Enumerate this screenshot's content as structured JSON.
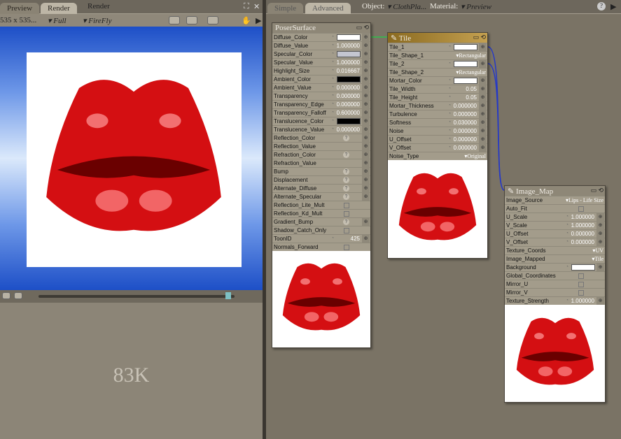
{
  "left": {
    "tabs": [
      "Preview",
      "Render"
    ],
    "title": "Render",
    "resolution": "535 x 535...",
    "quality": "Full",
    "renderer": "FireFly",
    "file_size": "83K"
  },
  "right": {
    "tabs": [
      "Simple",
      "Advanced"
    ],
    "object_label": "Object:",
    "object_value": "ClothPla...",
    "material_label": "Material:",
    "material_value": "Preview",
    "help": "?"
  },
  "nodes": [
    {
      "title": "PoserSurface",
      "rows": [
        {
          "label": "Diffuse_Color",
          "kind": "color",
          "color": "#ffffff"
        },
        {
          "label": "Diffuse_Value",
          "kind": "value",
          "value": "1.000000"
        },
        {
          "label": "Specular_Color",
          "kind": "color",
          "color": "#c4c6d0"
        },
        {
          "label": "Specular_Value",
          "kind": "value",
          "value": "1.000000"
        },
        {
          "label": "Highlight_Size",
          "kind": "value",
          "value": "0.016667"
        },
        {
          "label": "Ambient_Color",
          "kind": "color",
          "color": "#000000"
        },
        {
          "label": "Ambient_Value",
          "kind": "value",
          "value": "0.000000"
        },
        {
          "label": "Transparency",
          "kind": "value",
          "value": "0.000000"
        },
        {
          "label": "Transparency_Edge",
          "kind": "value",
          "value": "0.000000"
        },
        {
          "label": "Transparency_Falloff",
          "kind": "value",
          "value": "0.600000"
        },
        {
          "label": "Translucence_Color",
          "kind": "color",
          "color": "#000000"
        },
        {
          "label": "Translucence_Value",
          "kind": "value",
          "value": "0.000000"
        },
        {
          "label": "Reflection_Color",
          "kind": "q"
        },
        {
          "label": "Reflection_Value",
          "kind": "none"
        },
        {
          "label": "Refraction_Color",
          "kind": "q"
        },
        {
          "label": "Refraction_Value",
          "kind": "none"
        },
        {
          "label": "Bump",
          "kind": "q"
        },
        {
          "label": "Displacement",
          "kind": "q"
        },
        {
          "label": "Alternate_Diffuse",
          "kind": "q"
        },
        {
          "label": "Alternate_Specular",
          "kind": "q"
        },
        {
          "label": "Reflection_Lite_Mult",
          "kind": "check"
        },
        {
          "label": "Reflection_Kd_Mult",
          "kind": "check"
        },
        {
          "label": "Gradient_Bump",
          "kind": "q"
        },
        {
          "label": "Shadow_Catch_Only",
          "kind": "check"
        },
        {
          "label": "ToonID",
          "kind": "value",
          "value": "425"
        },
        {
          "label": "Normals_Forward",
          "kind": "check"
        }
      ]
    },
    {
      "title": "Tile",
      "rows": [
        {
          "label": "Tile_1",
          "kind": "color",
          "color": "#ffffff"
        },
        {
          "label": "Tile_Shape_1",
          "kind": "dd",
          "value": "Rectangular"
        },
        {
          "label": "Tile_2",
          "kind": "color",
          "color": "#ffffff"
        },
        {
          "label": "Tile_Shape_2",
          "kind": "dd",
          "value": "Rectangular"
        },
        {
          "label": "Mortar_Color",
          "kind": "color",
          "color": "#ffffff"
        },
        {
          "label": "Tile_Width",
          "kind": "value",
          "value": "0.05"
        },
        {
          "label": "Tile_Height",
          "kind": "value",
          "value": "0.05"
        },
        {
          "label": "Mortar_Thickness",
          "kind": "value",
          "value": "0.000000"
        },
        {
          "label": "Turbulence",
          "kind": "value",
          "value": "0.000000"
        },
        {
          "label": "Softness",
          "kind": "value",
          "value": "0.030000"
        },
        {
          "label": "Noise",
          "kind": "value",
          "value": "0.000000"
        },
        {
          "label": "U_Offset",
          "kind": "value",
          "value": "0.000000"
        },
        {
          "label": "V_Offset",
          "kind": "value",
          "value": "0.000000"
        },
        {
          "label": "Noise_Type",
          "kind": "dd",
          "value": "Original"
        }
      ]
    },
    {
      "title": "Image_Map",
      "rows": [
        {
          "label": "Image_Source",
          "kind": "dd",
          "value": "Lips - Life Size"
        },
        {
          "label": "Auto_Fit",
          "kind": "check"
        },
        {
          "label": "U_Scale",
          "kind": "value",
          "value": "1.000000"
        },
        {
          "label": "V_Scale",
          "kind": "value",
          "value": "1.000000"
        },
        {
          "label": "U_Offset",
          "kind": "value",
          "value": "0.000000"
        },
        {
          "label": "V_Offset",
          "kind": "value",
          "value": "0.000000"
        },
        {
          "label": "Texture_Coords",
          "kind": "dd",
          "value": "UV"
        },
        {
          "label": "Image_Mapped",
          "kind": "dd",
          "value": "Tile"
        },
        {
          "label": "Background",
          "kind": "color",
          "color": "#ffffff"
        },
        {
          "label": "Global_Coordinates",
          "kind": "check"
        },
        {
          "label": "Mirror_U",
          "kind": "check"
        },
        {
          "label": "Mirror_V",
          "kind": "check"
        },
        {
          "label": "Texture_Strength",
          "kind": "value",
          "value": "1.000000"
        }
      ]
    }
  ]
}
